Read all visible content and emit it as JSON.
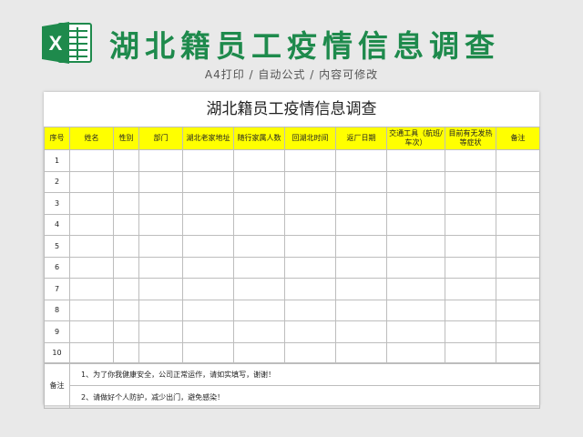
{
  "banner": {
    "title": "湖北籍员工疫情信息调查",
    "subtitle": "A4打印 / 自动公式 / 内容可修改"
  },
  "colors": {
    "accent_green": "#1e8a4c",
    "header_yellow": "#ffff00",
    "grid_border": "#bdbdbd"
  },
  "logo": {
    "icon": "excel-logo-icon",
    "letter": "X"
  },
  "sheet": {
    "title": "湖北籍员工疫情信息调查",
    "columns": [
      "序号",
      "姓名",
      "性别",
      "部门",
      "湖北老家地址",
      "随行家属人数",
      "回湖北时间",
      "返厂日期",
      "交通工具（航班/车次）",
      "目前有无发热等症状",
      "备注"
    ],
    "rows": [
      "1",
      "2",
      "3",
      "4",
      "5",
      "6",
      "7",
      "8",
      "9",
      "10"
    ],
    "notes": {
      "label": "备注",
      "lines": [
        "1、为了你我健康安全，公司正常运作，请如实填写，谢谢！",
        "2、请做好个人防护，减少出门，避免感染！"
      ]
    }
  }
}
